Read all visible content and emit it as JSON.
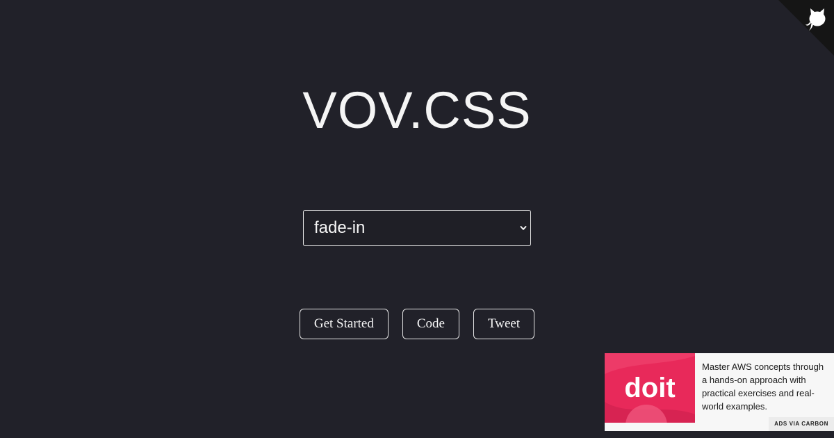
{
  "header": {
    "title": "VOV.CSS",
    "github_corner_icon": "github-octocat-icon"
  },
  "animation_select": {
    "selected": "fade-in",
    "chevron_icon": "chevron-down-icon"
  },
  "actions": {
    "get_started_label": "Get Started",
    "code_label": "Code",
    "tweet_label": "Tweet"
  },
  "ad": {
    "logo_text": "doit",
    "text": "Master AWS concepts through a hands-on approach with practical exercises and real-world examples.",
    "via_label": "ads via Carbon",
    "brand_color": "#e8295a"
  },
  "colors": {
    "background": "#212129",
    "foreground": "#f5f5f5",
    "border": "#e8e8e8"
  }
}
